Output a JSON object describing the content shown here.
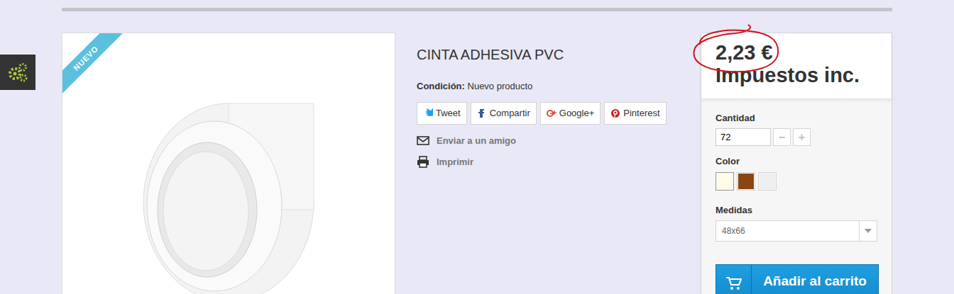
{
  "badge": "NUEVO",
  "product": {
    "title": "CINTA ADHESIVA PVC",
    "condition_label": "Condición:",
    "condition": "Nuevo producto"
  },
  "share_buttons": [
    {
      "label": "Tweet"
    },
    {
      "label": "Compartir"
    },
    {
      "label": "Google+"
    },
    {
      "label": "Pinterest"
    }
  ],
  "links": [
    {
      "label": "Enviar a un amigo"
    },
    {
      "label": "Imprimir"
    }
  ],
  "price": {
    "value": "2,23 €",
    "tax_note": "Impuestos inc."
  },
  "quantity": {
    "label": "Cantidad",
    "value": "72",
    "minus": "−",
    "plus": "+"
  },
  "colors": {
    "label": "Color",
    "swatches": [
      {
        "color": "#fffbe6",
        "selected": true
      },
      {
        "color": "#8b4513",
        "selected": false
      },
      {
        "color": "#efefef",
        "selected": false
      }
    ]
  },
  "size": {
    "label": "Medidas",
    "value": "48x66"
  },
  "add_to_cart": "Añadir al carrito"
}
